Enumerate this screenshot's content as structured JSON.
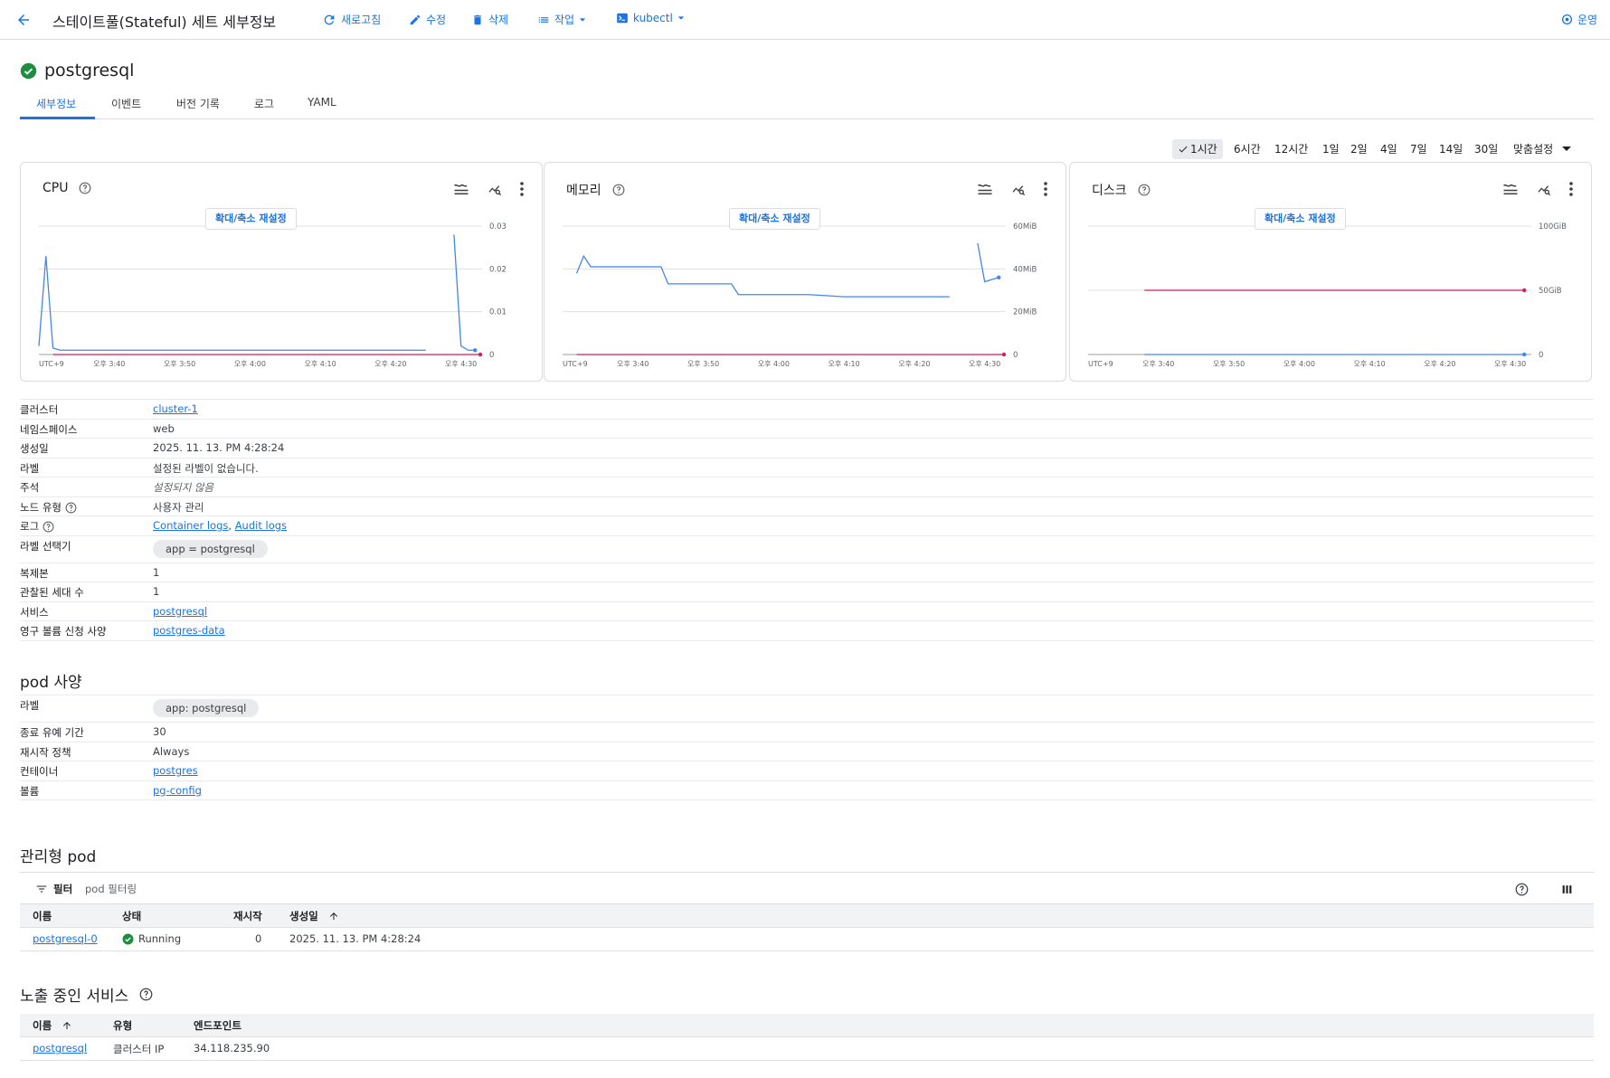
{
  "header": {
    "title": "스테이트풀(Stateful) 세트 세부정보",
    "refresh": "새로고침",
    "edit": "수정",
    "delete": "삭제",
    "actions": "작업",
    "kubectl": "kubectl",
    "operations": "운영"
  },
  "resource": {
    "name": "postgresql",
    "status": "ok"
  },
  "tabs": [
    "세부정보",
    "이벤트",
    "버전 기록",
    "로그",
    "YAML"
  ],
  "time_range": [
    "1시간",
    "6시간",
    "12시간",
    "1일",
    "2일",
    "4일",
    "7일",
    "14일",
    "30일",
    "맞춤설정"
  ],
  "time_range_selected": "1시간",
  "charts": [
    {
      "title": "CPU",
      "reset": "확대/축소 재설정",
      "y_ticks": [
        "0.03",
        "0.02",
        "0.01",
        "0"
      ],
      "tz": "UTC+9",
      "x_ticks": [
        "오후 3:40",
        "오후 3:50",
        "오후 4:00",
        "오후 4:10",
        "오후 4:20",
        "오후 4:30"
      ]
    },
    {
      "title": "메모리",
      "reset": "확대/축소 재설정",
      "y_ticks": [
        "60MiB",
        "40MiB",
        "20MiB",
        "0"
      ],
      "tz": "UTC+9",
      "x_ticks": [
        "오후 3:40",
        "오후 3:50",
        "오후 4:00",
        "오후 4:10",
        "오후 4:20",
        "오후 4:30"
      ]
    },
    {
      "title": "디스크",
      "reset": "확대/축소 재설정",
      "y_ticks": [
        "100GiB",
        "50GiB",
        "0"
      ],
      "tz": "UTC+9",
      "x_ticks": [
        "오후 3:40",
        "오후 3:50",
        "오후 4:00",
        "오후 4:10",
        "오후 4:20",
        "오후 4:30"
      ]
    }
  ],
  "chart_data": [
    {
      "type": "line",
      "title": "CPU",
      "ylim": [
        0,
        0.03
      ],
      "x": [
        "15:30",
        "15:31",
        "15:32",
        "15:33",
        "15:35",
        "15:40",
        "15:45",
        "15:50",
        "15:55",
        "16:00",
        "16:05",
        "16:10",
        "16:15",
        "16:20",
        "16:25",
        "16:28",
        "16:29",
        "16:30",
        "16:31",
        "16:32"
      ],
      "series": [
        {
          "name": "",
          "values": [
            0.002,
            0.023,
            0.0015,
            0.001,
            0.001,
            0.001,
            0.001,
            0.001,
            0.001,
            0.001,
            0.001,
            0.001,
            0.001,
            0.001,
            0.001,
            null,
            0.028,
            0.002,
            0.001,
            0.001
          ]
        }
      ]
    },
    {
      "type": "line",
      "title": "메모리",
      "ylim": [
        0,
        60
      ],
      "x": [
        "15:32",
        "15:33",
        "15:34",
        "15:40",
        "15:44",
        "15:45",
        "15:50",
        "15:54",
        "15:55",
        "16:00",
        "16:05",
        "16:10",
        "16:20",
        "16:25",
        "16:28",
        "16:29",
        "16:30",
        "16:32"
      ],
      "series": [
        {
          "name": "",
          "values": [
            38,
            46,
            41,
            41,
            41,
            33,
            33,
            33,
            28,
            28,
            28,
            27,
            27,
            27,
            null,
            52,
            34,
            36
          ]
        }
      ]
    },
    {
      "type": "line",
      "title": "디스크",
      "ylim": [
        0,
        100
      ],
      "x": [
        "15:38",
        "16:28",
        "16:30",
        "16:32"
      ],
      "series": [
        {
          "name": "",
          "values": [
            50,
            50,
            50,
            50
          ]
        },
        {
          "name": "",
          "values": [
            0,
            0,
            0,
            0
          ]
        }
      ]
    }
  ],
  "details": [
    {
      "label": "클러스터",
      "value": "cluster-1",
      "type": "link"
    },
    {
      "label": "네임스페이스",
      "value": "web",
      "type": "text"
    },
    {
      "label": "생성일",
      "value": "2025. 11. 13. PM 4:28:24",
      "type": "text"
    },
    {
      "label": "라벨",
      "value": "설정된 라벨이 없습니다.",
      "type": "text"
    },
    {
      "label": "주석",
      "value": "설정되지 않음",
      "type": "italic"
    },
    {
      "label": "노드 유형",
      "value": "사용자 관리",
      "type": "text"
    },
    {
      "label": "로그",
      "value": "Container logs",
      "value2": "Audit logs",
      "type": "links"
    },
    {
      "label": "라벨 선택기",
      "value": "app = postgresql",
      "type": "chip"
    },
    {
      "label": "복제본",
      "value": "1",
      "type": "text"
    },
    {
      "label": "관찰된 세대 수",
      "value": "1",
      "type": "text"
    },
    {
      "label": "서비스",
      "value": "postgresql",
      "type": "link"
    },
    {
      "label": "영구 볼륨 신청 사양",
      "value": "postgres-data",
      "type": "link"
    }
  ],
  "pod_spec": {
    "title": "pod 사양",
    "rows": [
      {
        "label": "라벨",
        "value": "app: postgresql",
        "type": "chip"
      },
      {
        "label": "종료 유예 기간",
        "value": "30",
        "type": "text"
      },
      {
        "label": "재시작 정책",
        "value": "Always",
        "type": "text"
      },
      {
        "label": "컨테이너",
        "value": "postgres",
        "type": "link"
      },
      {
        "label": "볼륨",
        "value": "pg-config",
        "type": "link"
      }
    ]
  },
  "managed_pods": {
    "title": "관리형 pod",
    "filter_label": "필터",
    "filter_placeholder": "pod 필터링",
    "columns": [
      "이름",
      "상태",
      "재시작",
      "생성일"
    ],
    "rows": [
      {
        "name": "postgresql-0",
        "status": "Running",
        "restarts": "0",
        "created": "2025. 11. 13. PM 4:28:24"
      }
    ]
  },
  "services": {
    "title": "노출 중인 서비스",
    "columns": [
      "이름",
      "유형",
      "엔드포인트"
    ],
    "rows": [
      {
        "name": "postgresql",
        "type": "클러스터 IP",
        "endpoint": "34.118.235.90"
      }
    ]
  },
  "colors": {
    "accent": "#1a73e8",
    "series_blue": "#4285f4",
    "series_red": "#d81b60",
    "ok_green": "#1e8e3e"
  }
}
